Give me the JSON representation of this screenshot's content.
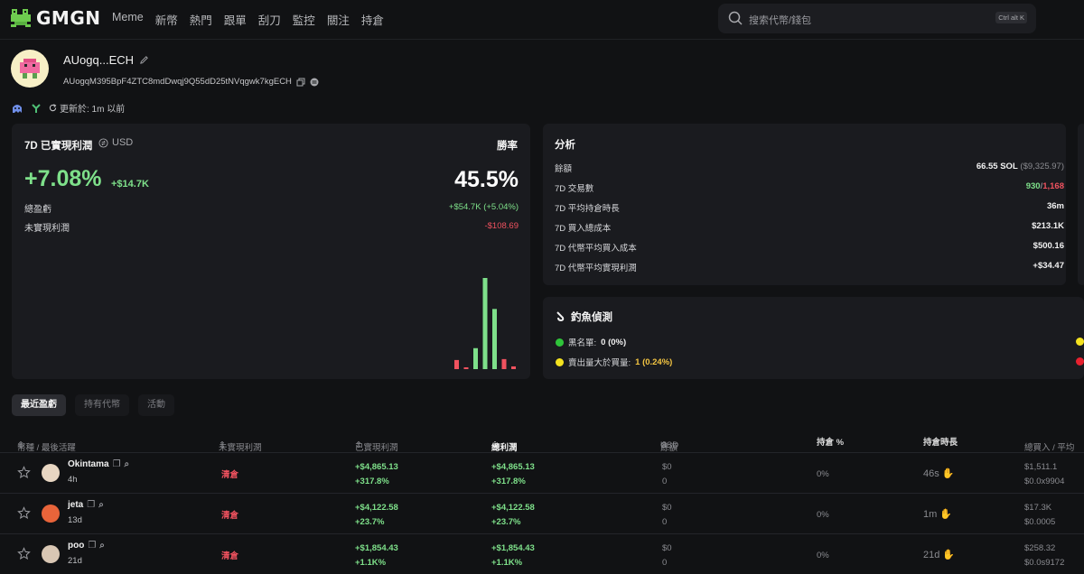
{
  "nav": {
    "logo": "GMGN",
    "menu": [
      "Meme",
      "新幣",
      "熱門",
      "跟單",
      "刮刀",
      "監控",
      "關注",
      "持倉"
    ],
    "search_placeholder": "搜索代幣/錢包",
    "search_shortcut": "Ctrl alt K"
  },
  "profile": {
    "name": "AUogq...ECH",
    "address": "AUogqM395BpF4ZTC8mdDwqj9Q55dD25tNVqgwk7kgECH",
    "updated": "更新於: 1m 以前"
  },
  "pnl": {
    "title": "7D 已實現利潤",
    "currency": "USD",
    "winrate_label": "勝率",
    "pct": "+7.08%",
    "usd": "+$14.7K",
    "winrate": "45.5%",
    "total_label": "總盈虧",
    "total_value": "+$54.7K (+5.04%)",
    "unrealized_label": "未實現利潤",
    "unrealized_value": "-$108.69"
  },
  "chart_data": {
    "type": "bar",
    "series": [
      {
        "values": [
          0.1,
          0.02,
          0.23,
          1.0,
          0.66,
          0.11,
          0.03
        ]
      }
    ],
    "colors": [
      "#f0525f",
      "#f0525f",
      "#7ee08a",
      "#7ee08a",
      "#7ee08a",
      "#f0525f",
      "#f0525f"
    ]
  },
  "analysis": {
    "title": "分析",
    "rows": [
      {
        "label": "餘額",
        "value": "66.55 SOL",
        "extra": "($9,325.97)"
      },
      {
        "label": "7D 交易數",
        "value_green": "930",
        "value_red": "1,168"
      },
      {
        "label": "7D 平均持倉時長",
        "value": "36m"
      },
      {
        "label": "7D 買入總成本",
        "value": "$213.1K"
      },
      {
        "label": "7D 代幣平均買入成本",
        "value": "$500.16"
      },
      {
        "label": "7D 代幣平均實現利潤",
        "value": "+$34.47"
      }
    ]
  },
  "phishing": {
    "title": "釣魚偵測",
    "rows": [
      {
        "label": "黑名單:",
        "value": "0 (0%)"
      },
      {
        "label": "賣出量大於買量:",
        "value": "1 (0.24%)"
      }
    ]
  },
  "tabs": [
    "最近盈虧",
    "持有代幣",
    "活動"
  ],
  "table": {
    "headers": {
      "token": "幣種 / 最後活躍",
      "unrealized": "未實現利潤",
      "realized": "已實現利潤",
      "total": "總利潤",
      "balance": "餘額",
      "usd": "USD",
      "hold_pct": "持倉 %",
      "hold_time": "持倉時長",
      "total_buy": "總買入 / 平均"
    },
    "rows": [
      {
        "name": "Okintama",
        "age": "4h",
        "unrealized": "清倉",
        "realized": "+$4,865.13",
        "realized_pct": "+317.8%",
        "total": "+$4,865.13",
        "total_pct": "+317.8%",
        "balance": "$0",
        "balance_sub": "0",
        "hold_pct": "0%",
        "hold_time": "46s",
        "buy": "$1,511.1",
        "buy_avg": "$0.0x9904"
      },
      {
        "name": "jeta",
        "age": "13d",
        "unrealized": "清倉",
        "realized": "+$4,122.58",
        "realized_pct": "+23.7%",
        "total": "+$4,122.58",
        "total_pct": "+23.7%",
        "balance": "$0",
        "balance_sub": "0",
        "hold_pct": "0%",
        "hold_time": "1m",
        "buy": "$17.3K",
        "buy_avg": "$0.0005"
      },
      {
        "name": "poo",
        "age": "21d",
        "unrealized": "清倉",
        "realized": "+$1,854.43",
        "realized_pct": "+1.1K%",
        "total": "+$1,854.43",
        "total_pct": "+1.1K%",
        "balance": "$0",
        "balance_sub": "0",
        "hold_pct": "0%",
        "hold_time": "21d",
        "buy": "$258.32",
        "buy_avg": "$0.0s9172"
      }
    ]
  }
}
